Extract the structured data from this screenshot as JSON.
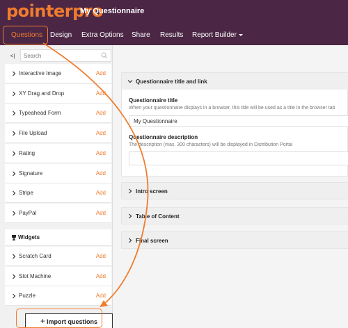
{
  "header": {
    "logo": "pointerpro",
    "title": "My Questionnaire"
  },
  "nav": {
    "tabs": [
      {
        "label": "Questions"
      },
      {
        "label": "Design"
      },
      {
        "label": "Extra Options"
      },
      {
        "label": "Share"
      },
      {
        "label": "Results"
      },
      {
        "label": "Report Builder"
      }
    ]
  },
  "sidebar": {
    "collapse_label": "<|",
    "search_placeholder": "Search",
    "add_label": "Add",
    "items": [
      {
        "label": "Interactive Image"
      },
      {
        "label": "XY Drag and Drop"
      },
      {
        "label": "Typeahead Form"
      },
      {
        "label": "File Upload"
      },
      {
        "label": "Rating"
      },
      {
        "label": "Signature"
      },
      {
        "label": "Stripe"
      },
      {
        "label": "PayPal"
      }
    ],
    "widgets_header": "Widgets",
    "widgets": [
      {
        "label": "Scratch Card"
      },
      {
        "label": "Slot Machine"
      },
      {
        "label": "Puzzle"
      }
    ],
    "import_label": "Import questions",
    "import_icon": "+"
  },
  "main": {
    "section_title": "Questionnaire title and link",
    "title_label": "Questionnaire title",
    "title_hint": "When your questionnaire displays in a browser, this title will be used as a title in the browser tab",
    "title_value": "My Questionnaire",
    "desc_label": "Questionnaire description",
    "desc_hint": "The description (max. 300 characters) will be displayed in Distribution Portal",
    "desc_value": "",
    "sections": [
      {
        "label": "Intro screen"
      },
      {
        "label": "Table of Content"
      },
      {
        "label": "Final screen"
      }
    ]
  },
  "colors": {
    "brand_dark": "#4b2745",
    "accent": "#f07c2e"
  }
}
